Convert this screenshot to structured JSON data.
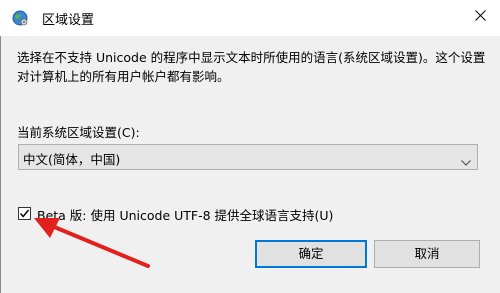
{
  "window": {
    "title": "区域设置",
    "close_icon": "close-icon"
  },
  "body": {
    "description": "选择在不支持 Unicode 的程序中显示文本时所使用的语言(系统区域设置)。这个设置对计算机上的所有用户帐户都有影响。",
    "current_locale_label": "当前系统区域设置(C):",
    "current_locale_value": "中文(简体，中国)",
    "utf8_checkbox_label": "Beta 版: 使用 Unicode UTF-8 提供全球语言支持(U)",
    "utf8_checked": true
  },
  "buttons": {
    "ok_label": "确定",
    "cancel_label": "取消"
  },
  "annotation": {
    "arrow_color": "#e0211c"
  },
  "colors": {
    "window_bg": "#f0f0f0",
    "accent_focus": "#0078d7"
  }
}
